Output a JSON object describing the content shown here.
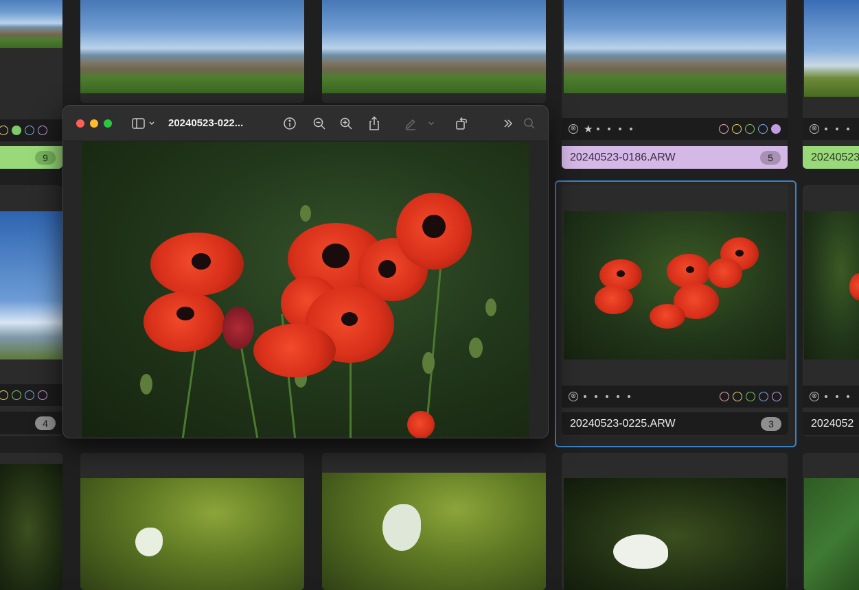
{
  "grid": {
    "cells": [
      {
        "id": "top-left",
        "count": "9",
        "label_color": "green"
      },
      {
        "id": "top-mid-1"
      },
      {
        "id": "top-mid-2"
      },
      {
        "id": "top-right-1",
        "filename": "20240523-0186.ARW",
        "count": "5",
        "label_color": "purple"
      },
      {
        "id": "top-right-2",
        "filename": "20240523",
        "label_color": "green"
      },
      {
        "id": "mid-left",
        "count": "4"
      },
      {
        "id": "selected",
        "filename": "20240523-0225.ARW",
        "count": "3"
      },
      {
        "id": "mid-right-2",
        "filename": "2024052"
      }
    ],
    "reject_symbol": "⊗",
    "star_symbol": "★",
    "color_labels": [
      "#e9a3b2",
      "#e0d36a",
      "#7fc96a",
      "#7da8e6",
      "#c39be0"
    ]
  },
  "quicklook": {
    "title": "20240523-022...",
    "toolbar": {
      "sidebar_icon": "sidebar-icon",
      "info_icon": "info-icon",
      "zoom_out_icon": "zoom-out-icon",
      "zoom_in_icon": "zoom-in-icon",
      "share_icon": "share-icon",
      "markup_icon": "markup-icon",
      "rotate_icon": "rotate-icon",
      "more_icon": "chevron-double-right-icon",
      "search_icon": "search-icon"
    },
    "traffic": {
      "close": "#fe5f57",
      "minimize": "#febc2e",
      "zoom": "#28c840"
    }
  }
}
